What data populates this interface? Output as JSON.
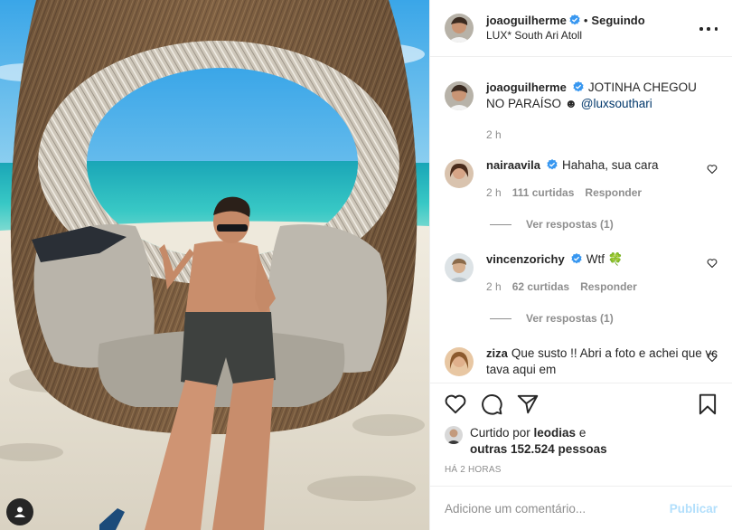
{
  "post": {
    "author": "joaoguilherme",
    "follow_dot": "•",
    "follow_label": "Seguindo",
    "location": "LUX* South Ari Atoll"
  },
  "caption": {
    "username": "joaoguilherme",
    "text": "JOTINHA CHEGOU NO PARAÍSO ☻ ",
    "mention": "@luxsouthari",
    "time": "2 h"
  },
  "comments": [
    {
      "username": "nairaavila",
      "verified": true,
      "text": "Hahaha, sua cara",
      "time": "2 h",
      "likes": "111 curtidas",
      "reply": "Responder",
      "view_replies": "Ver respostas (1)"
    },
    {
      "username": "vincenzorichy",
      "verified": true,
      "text": "Wtf 🍀",
      "time": "2 h",
      "likes": "62 curtidas",
      "reply": "Responder",
      "view_replies": "Ver respostas (1)"
    },
    {
      "username": "ziza",
      "verified": false,
      "text": "Que susto !! Abri a foto e achei que vc tava aqui em"
    }
  ],
  "likes": {
    "prefix": "Curtido por ",
    "user": "leodias",
    "middle": " e",
    "others": "outras 152.524 pessoas"
  },
  "time_ago": "HÁ 2 HORAS",
  "add_comment": {
    "placeholder": "Adicione um comentário...",
    "publish_label": "Publicar"
  },
  "icons": {
    "verified": "verified-badge-icon",
    "more": "more-options-icon",
    "heart": "heart-icon",
    "comment": "comment-icon",
    "share": "share-icon",
    "save": "bookmark-icon",
    "user": "user-tag-icon"
  },
  "colors": {
    "verified": "#3897f0",
    "link": "#00376b",
    "muted": "#8e8e8e",
    "publish_disabled": "#b2dffc"
  }
}
